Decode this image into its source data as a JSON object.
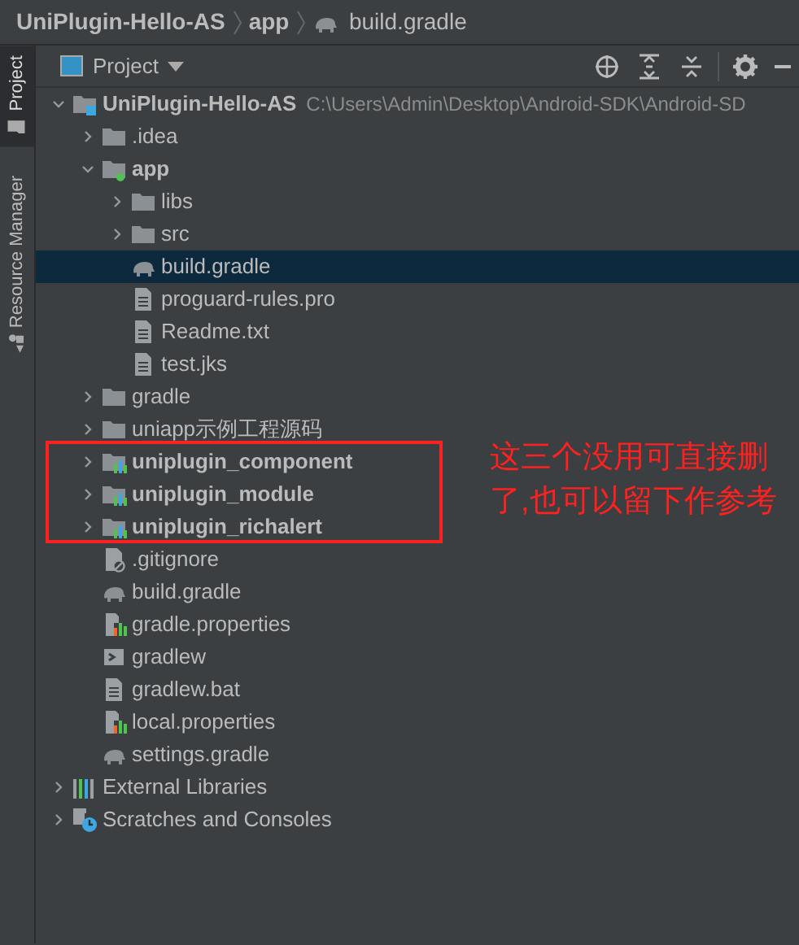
{
  "breadcrumbs": [
    {
      "label": "UniPlugin-Hello-AS",
      "kind": "project"
    },
    {
      "label": "app",
      "kind": "module"
    },
    {
      "label": "build.gradle",
      "kind": "gradle"
    }
  ],
  "side_tabs": [
    {
      "label": "Project",
      "selected": true,
      "kind": "project"
    },
    {
      "label": "Resource Manager",
      "selected": false,
      "kind": "resources"
    }
  ],
  "toolbar": {
    "view": "Project"
  },
  "tree": [
    {
      "label": "UniPlugin-Hello-AS",
      "path": "C:\\Users\\Admin\\Desktop\\Android-SDK\\Android-SD",
      "kind": "project",
      "expanded": true,
      "selected": false,
      "children": [
        {
          "label": ".idea",
          "kind": "folder",
          "expanded": false,
          "selected": false
        },
        {
          "label": "app",
          "kind": "app",
          "expanded": true,
          "selected": false,
          "children": [
            {
              "label": "libs",
              "kind": "folder",
              "expanded": false,
              "selected": false
            },
            {
              "label": "src",
              "kind": "folder",
              "expanded": false,
              "selected": false
            },
            {
              "label": "build.gradle",
              "kind": "gradle",
              "selected": true
            },
            {
              "label": "proguard-rules.pro",
              "kind": "text",
              "selected": false
            },
            {
              "label": "Readme.txt",
              "kind": "text",
              "selected": false
            },
            {
              "label": "test.jks",
              "kind": "text",
              "selected": false
            }
          ]
        },
        {
          "label": "gradle",
          "kind": "folder",
          "expanded": false,
          "selected": false
        },
        {
          "label": "uniapp示例工程源码",
          "kind": "folder",
          "expanded": false,
          "selected": false
        },
        {
          "label": "uniplugin_component",
          "kind": "module",
          "expanded": false,
          "selected": false
        },
        {
          "label": "uniplugin_module",
          "kind": "module",
          "expanded": false,
          "selected": false
        },
        {
          "label": "uniplugin_richalert",
          "kind": "module",
          "expanded": false,
          "selected": false
        },
        {
          "label": ".gitignore",
          "kind": "ignore",
          "selected": false
        },
        {
          "label": "build.gradle",
          "kind": "gradle",
          "selected": false
        },
        {
          "label": "gradle.properties",
          "kind": "properties",
          "selected": false
        },
        {
          "label": "gradlew",
          "kind": "script",
          "selected": false
        },
        {
          "label": "gradlew.bat",
          "kind": "text",
          "selected": false
        },
        {
          "label": "local.properties",
          "kind": "properties",
          "selected": false
        },
        {
          "label": "settings.gradle",
          "kind": "gradle",
          "selected": false
        }
      ]
    },
    {
      "label": "External Libraries",
      "kind": "libraries",
      "expanded": false,
      "selected": false
    },
    {
      "label": "Scratches and Consoles",
      "kind": "scratches",
      "expanded": false,
      "selected": false
    }
  ],
  "annotation": {
    "text": "这三个没用可直接删了,也可以留下作参考"
  }
}
